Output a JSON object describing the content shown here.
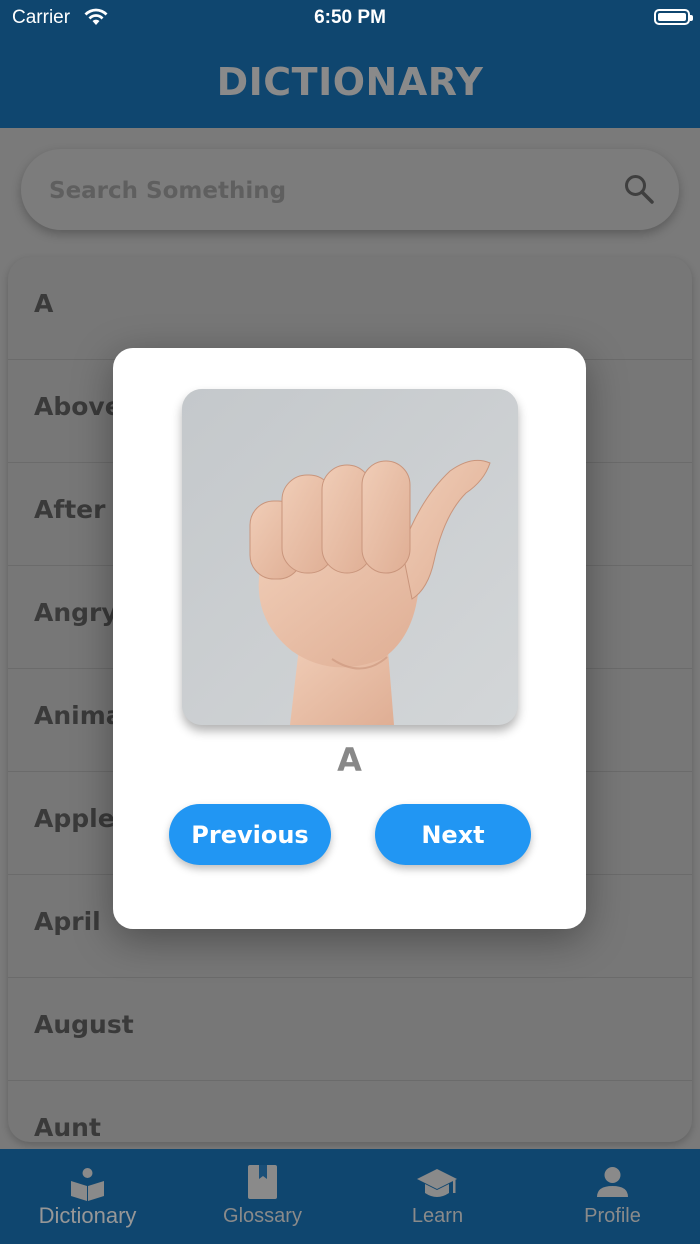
{
  "status_bar": {
    "carrier": "Carrier",
    "time": "6:50 PM"
  },
  "header": {
    "title": "DICTIONARY"
  },
  "search": {
    "placeholder": "Search Something"
  },
  "list": {
    "items": [
      "A",
      "Above",
      "After",
      "Angry",
      "Animal",
      "Apple",
      "April",
      "August",
      "Aunt"
    ]
  },
  "modal": {
    "letter": "A",
    "previous_label": "Previous",
    "next_label": "Next"
  },
  "tabs": [
    {
      "label": "Dictionary",
      "icon": "dictionary-icon",
      "active": true
    },
    {
      "label": "Glossary",
      "icon": "book-icon",
      "active": false
    },
    {
      "label": "Learn",
      "icon": "graduation-cap-icon",
      "active": false
    },
    {
      "label": "Profile",
      "icon": "person-icon",
      "active": false
    }
  ],
  "colors": {
    "header_bg": "#0f466f",
    "accent_button": "#2196f3",
    "overlay_dim": "#7a7a7a"
  }
}
